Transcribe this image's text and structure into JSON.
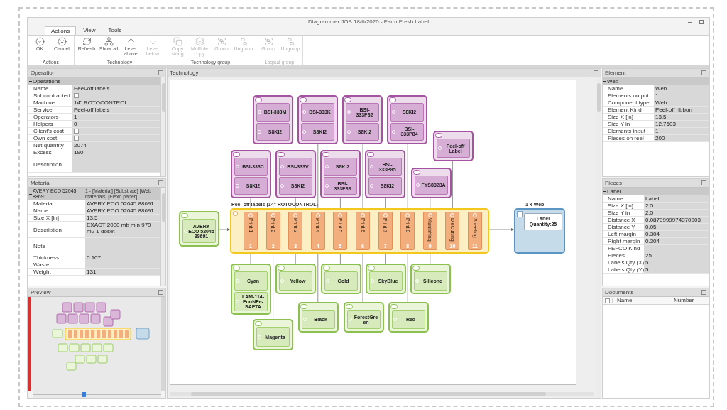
{
  "window": {
    "title": "Diagrammer JOB 18/6/2020 - Farm Fresh Label"
  },
  "ribbon": {
    "tabs": [
      {
        "label": "Actions",
        "selected": true
      },
      {
        "label": "View",
        "selected": false
      },
      {
        "label": "Tools",
        "selected": false
      }
    ],
    "groups": [
      {
        "label": "Actions",
        "disabled": false,
        "buttons": [
          {
            "label": "OK",
            "disabled": false
          },
          {
            "label": "Cancel",
            "disabled": false
          }
        ]
      },
      {
        "label": "Technology",
        "disabled": false,
        "buttons": [
          {
            "label": "Refresh",
            "disabled": false
          },
          {
            "label": "Show all",
            "disabled": false
          },
          {
            "label": "Level above",
            "disabled": false
          },
          {
            "label": "Level below",
            "disabled": true
          }
        ]
      },
      {
        "label": "Technology group",
        "disabled": false,
        "buttons": [
          {
            "label": "Copy string",
            "disabled": true
          },
          {
            "label": "Multiple copy",
            "disabled": true
          },
          {
            "label": "Group",
            "disabled": true
          },
          {
            "label": "Ungroup",
            "disabled": true
          }
        ]
      },
      {
        "label": "Logical group",
        "disabled": true,
        "buttons": [
          {
            "label": "Group",
            "disabled": true
          },
          {
            "label": "Ungroup",
            "disabled": true
          }
        ]
      }
    ]
  },
  "operation": {
    "title": "Operation",
    "group": "Operations",
    "rows": [
      {
        "kind": "text",
        "label": "Name",
        "value": "Peel-off labels"
      },
      {
        "kind": "check",
        "label": "Subcontracted",
        "checked": false
      },
      {
        "kind": "text",
        "label": "Machine",
        "value": "14\" ROTOCONTROL"
      },
      {
        "kind": "text",
        "label": "Service",
        "value": "Peel-off labels"
      },
      {
        "kind": "text",
        "label": "Operators",
        "value": "1"
      },
      {
        "kind": "text",
        "label": "Helpers",
        "value": "0"
      },
      {
        "kind": "check",
        "label": "Client's cost",
        "checked": false
      },
      {
        "kind": "check",
        "label": "Own cost",
        "checked": false
      },
      {
        "kind": "text",
        "label": "Net quantity",
        "value": "2074"
      },
      {
        "kind": "text",
        "label": "Excess",
        "value": "190"
      },
      {
        "kind": "memo",
        "label": "Description"
      }
    ]
  },
  "material": {
    "title": "Material",
    "group": {
      "label": "AVERY ECO 52045 88691",
      "value": "1 - [Material] [Substrate] [Web materials] [Flexo paper]"
    },
    "rows": [
      {
        "kind": "text",
        "label": "Material",
        "value": "AVERY ECO 52045 88691"
      },
      {
        "kind": "text",
        "label": "Name",
        "value": "AVERY ECO 52045 88691"
      },
      {
        "kind": "text",
        "label": "Size X [in]",
        "value": "13.5"
      },
      {
        "kind": "memo",
        "label": "Description",
        "value": "EXACT 2000 mb  min 970 m2  1 doset"
      },
      {
        "kind": "memo",
        "label": "Note"
      },
      {
        "kind": "text",
        "label": "Thickness",
        "value": "0.107"
      },
      {
        "kind": "text",
        "label": "Waste"
      },
      {
        "kind": "text",
        "label": "Weight",
        "value": "131"
      }
    ]
  },
  "preview": {
    "title": "Preview",
    "zoom": {
      "level": 0.4
    }
  },
  "technology": {
    "title": "Technology",
    "machine": {
      "title": "Peel-off labels (14\" ROTOCONTROL)",
      "stations": [
        {
          "label": "Print 1",
          "number": "1"
        },
        {
          "label": "Print 2",
          "number": "2"
        },
        {
          "label": "Print 3",
          "number": "3"
        },
        {
          "label": "Print 4",
          "number": "4"
        },
        {
          "label": "Print 5",
          "number": "5"
        },
        {
          "label": "Print 6",
          "number": "6"
        },
        {
          "label": "Print 7",
          "number": "7"
        },
        {
          "label": "Print 8",
          "number": "8"
        },
        {
          "label": "Varnishing",
          "number": "9"
        },
        {
          "label": "DieCutting",
          "number": "10"
        },
        {
          "label": "Sheeting",
          "number": "11"
        }
      ]
    },
    "tools": [
      {
        "items": [
          "BSI-333M",
          "S8KI2"
        ]
      },
      {
        "items": [
          "BSI-333K",
          "S8KI2"
        ]
      },
      {
        "items": [
          "BSI-333P82",
          "S8KI2"
        ]
      },
      {
        "items": [
          "S8KI2",
          "BSI-333P84"
        ]
      },
      {
        "items": [
          "Peel-off Label"
        ]
      },
      {
        "items": [
          "BSI-333C",
          "S8KI2"
        ]
      },
      {
        "items": [
          "BSI-333V",
          "S8KI2"
        ]
      },
      {
        "items": [
          "S8KI2",
          "BSI-333P83"
        ]
      },
      {
        "items": [
          "BSI-333P85",
          "S8KI2"
        ]
      },
      {
        "items": [
          "FYS8323A"
        ]
      }
    ],
    "input": {
      "items": [
        "AVERY ECO 52045 88691"
      ]
    },
    "output": {
      "title": "1 x Web",
      "label": "Label Quantity:25"
    },
    "inks": [
      {
        "items": [
          "Cyan",
          "LAM-114-PooNPe-SAFTA"
        ]
      },
      {
        "items": [
          "Yellow"
        ]
      },
      {
        "items": [
          "Gold"
        ]
      },
      {
        "items": [
          "SkyBlue"
        ]
      },
      {
        "items": [
          "Silicone"
        ]
      },
      {
        "items": [
          "Black"
        ]
      },
      {
        "items": [
          "ForestGreen"
        ]
      },
      {
        "items": [
          "Red"
        ]
      },
      {
        "items": [
          "Magenta"
        ]
      }
    ]
  },
  "element": {
    "title": "Element",
    "group": "Web",
    "rows": [
      {
        "kind": "text",
        "label": "Name",
        "value": "Web"
      },
      {
        "kind": "text",
        "label": "Elements output",
        "value": "1"
      },
      {
        "kind": "text",
        "label": "Component type",
        "value": "Web"
      },
      {
        "kind": "text",
        "label": "Element Kind",
        "value": "Peel-off ribbon"
      },
      {
        "kind": "text",
        "label": "Size X [in]",
        "value": "13.5"
      },
      {
        "kind": "text",
        "label": "Size Y in",
        "value": "12.7603"
      },
      {
        "kind": "text",
        "label": "Elements input",
        "value": "1"
      },
      {
        "kind": "text",
        "label": "Pieces on reel",
        "value": "200"
      }
    ]
  },
  "pieces": {
    "title": "Pieces",
    "group": "Label",
    "rows": [
      {
        "kind": "text",
        "label": "Name",
        "value": "Label"
      },
      {
        "kind": "text",
        "label": "Size X [in]",
        "value": "2.5"
      },
      {
        "kind": "text",
        "label": "Size Y in",
        "value": "2.5"
      },
      {
        "kind": "text",
        "label": "Distance X",
        "value": "0.0879999974370003"
      },
      {
        "kind": "text",
        "label": "Distance Y",
        "value": "0.05"
      },
      {
        "kind": "text",
        "label": "Left margin",
        "value": "0.304"
      },
      {
        "kind": "text",
        "label": "Right margin",
        "value": "0.304"
      },
      {
        "kind": "text",
        "label": "FEFCO Kind"
      },
      {
        "kind": "text",
        "label": "Pieces",
        "value": "25"
      },
      {
        "kind": "text",
        "label": "Labels Qty (X)",
        "value": "5"
      },
      {
        "kind": "text",
        "label": "Labels Qty (Y)",
        "value": "5"
      }
    ]
  },
  "documents": {
    "title": "Documents",
    "select_all": {
      "checked": false
    },
    "columns": [
      "Name",
      "Number"
    ]
  }
}
